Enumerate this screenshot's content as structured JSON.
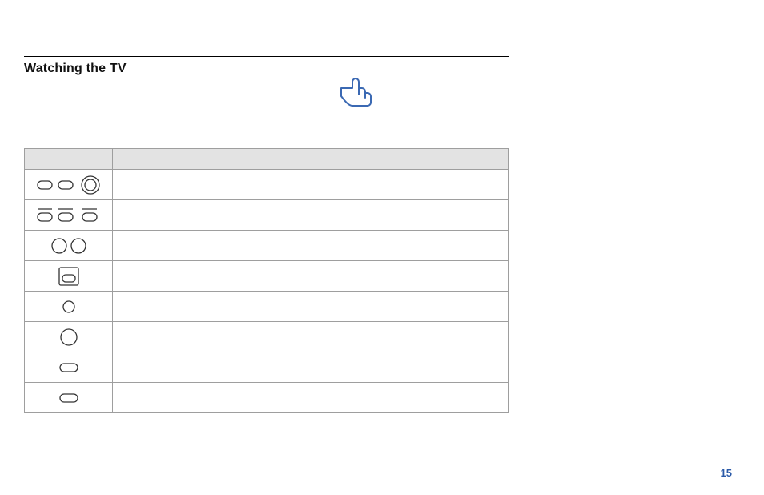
{
  "heading": "Watching the TV",
  "page_number": "15",
  "table": {
    "header": {
      "col1": "",
      "col2": ""
    },
    "rows": [
      {
        "icon": "row1",
        "desc": ""
      },
      {
        "icon": "row2",
        "desc": ""
      },
      {
        "icon": "row3",
        "desc": ""
      },
      {
        "icon": "row4",
        "desc": ""
      },
      {
        "icon": "row5",
        "desc": ""
      },
      {
        "icon": "row6",
        "desc": ""
      },
      {
        "icon": "row7",
        "desc": ""
      },
      {
        "icon": "row8",
        "desc": ""
      }
    ]
  }
}
